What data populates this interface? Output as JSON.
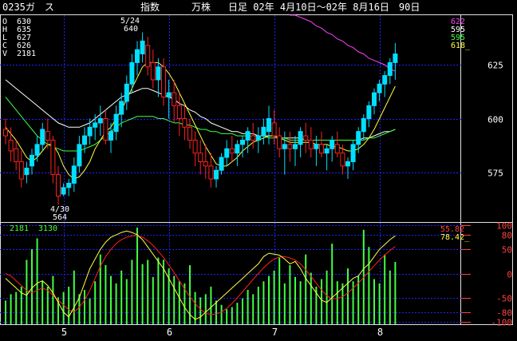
{
  "header": {
    "code": "0235ガ　ス",
    "indicator": "指数",
    "unit": "万株",
    "period": "日足 02年 4月10日～02年 8月16日　90日"
  },
  "ohlc_labels": [
    {
      "key": "O",
      "value": "630"
    },
    {
      "key": "H",
      "value": "635"
    },
    {
      "key": "L",
      "value": "627"
    },
    {
      "key": "C",
      "value": "626"
    },
    {
      "key": "V",
      "value": "2181"
    }
  ],
  "ma_values": [
    {
      "value": "622",
      "color": "#ff40ff"
    },
    {
      "value": "595",
      "color": "#ffffff"
    },
    {
      "value": "595",
      "color": "#40ff40"
    },
    {
      "value": "618_",
      "color": "#ffff40"
    }
  ],
  "osc_header": {
    "left": "2181",
    "right": "3130"
  },
  "osc_values": [
    {
      "value": "55.82",
      "color": "#ff4040"
    },
    {
      "value": "78.42_",
      "color": "#ffff40"
    }
  ],
  "annotations": [
    {
      "text": "5/24",
      "sub": "640"
    },
    {
      "text": "4/30",
      "sub": "564"
    }
  ],
  "colors": {
    "background": "#000000",
    "frame": "#e0e0e0",
    "grid": "#2020ff",
    "price_axis_text": "#ffffff",
    "osc_axis_text": "#ff4040",
    "up_candle": "#00e0ff",
    "down_candle": "#ff2020",
    "ma_short": "#ffff40",
    "ma_mid": "#ffffff",
    "ma_long": "#40ff40",
    "ma_xlong": "#ff40ff",
    "volume": "#40ff40"
  },
  "chart_data": [
    {
      "type": "candlestick",
      "title": "0235ガ　ス",
      "ylim": [
        552,
        648
      ],
      "yticks": [
        575,
        600,
        625
      ],
      "x_labels": [
        "5",
        "6",
        "7",
        "8"
      ],
      "x_label_index": [
        11,
        31,
        51,
        71
      ],
      "ohlc": [
        [
          595,
          600,
          588,
          592
        ],
        [
          590,
          596,
          580,
          585
        ],
        [
          586,
          590,
          576,
          580
        ],
        [
          580,
          585,
          568,
          572
        ],
        [
          574,
          580,
          570,
          577
        ],
        [
          578,
          586,
          574,
          583
        ],
        [
          583,
          592,
          580,
          588
        ],
        [
          588,
          598,
          585,
          595
        ],
        [
          594,
          600,
          586,
          590
        ],
        [
          590,
          592,
          570,
          574
        ],
        [
          574,
          578,
          560,
          564
        ],
        [
          565,
          570,
          564,
          568
        ],
        [
          568,
          572,
          564,
          570
        ],
        [
          570,
          582,
          566,
          578
        ],
        [
          578,
          592,
          575,
          588
        ],
        [
          588,
          596,
          584,
          592
        ],
        [
          592,
          600,
          588,
          596
        ],
        [
          596,
          602,
          590,
          598
        ],
        [
          598,
          606,
          592,
          600
        ],
        [
          600,
          604,
          588,
          590
        ],
        [
          590,
          598,
          584,
          594
        ],
        [
          594,
          606,
          590,
          602
        ],
        [
          602,
          612,
          596,
          608
        ],
        [
          608,
          620,
          604,
          616
        ],
        [
          616,
          630,
          612,
          626
        ],
        [
          626,
          636,
          620,
          632
        ],
        [
          630,
          640,
          626,
          636
        ],
        [
          634,
          638,
          620,
          624
        ],
        [
          626,
          632,
          614,
          618
        ],
        [
          618,
          628,
          610,
          624
        ],
        [
          624,
          628,
          606,
          610
        ],
        [
          610,
          618,
          600,
          612
        ],
        [
          612,
          618,
          598,
          606
        ],
        [
          606,
          612,
          592,
          600
        ],
        [
          600,
          606,
          590,
          596
        ],
        [
          596,
          600,
          586,
          590
        ],
        [
          590,
          594,
          578,
          584
        ],
        [
          584,
          590,
          574,
          580
        ],
        [
          580,
          588,
          572,
          578
        ],
        [
          578,
          584,
          568,
          572
        ],
        [
          572,
          578,
          568,
          576
        ],
        [
          576,
          584,
          574,
          582
        ],
        [
          582,
          590,
          578,
          586
        ],
        [
          586,
          592,
          580,
          584
        ],
        [
          584,
          590,
          578,
          588
        ],
        [
          588,
          592,
          582,
          590
        ],
        [
          590,
          596,
          584,
          594
        ],
        [
          592,
          598,
          586,
          590
        ],
        [
          590,
          596,
          584,
          592
        ],
        [
          592,
          600,
          588,
          596
        ],
        [
          594,
          606,
          588,
          600
        ],
        [
          598,
          604,
          588,
          592
        ],
        [
          592,
          596,
          582,
          586
        ],
        [
          586,
          594,
          574,
          588
        ],
        [
          588,
          594,
          580,
          586
        ],
        [
          586,
          592,
          578,
          588
        ],
        [
          588,
          596,
          582,
          594
        ],
        [
          592,
          598,
          584,
          590
        ],
        [
          590,
          596,
          582,
          586
        ],
        [
          586,
          592,
          578,
          588
        ],
        [
          588,
          594,
          582,
          584
        ],
        [
          584,
          588,
          576,
          586
        ],
        [
          586,
          592,
          580,
          590
        ],
        [
          588,
          594,
          582,
          584
        ],
        [
          584,
          588,
          574,
          578
        ],
        [
          578,
          582,
          572,
          580
        ],
        [
          580,
          590,
          576,
          588
        ],
        [
          588,
          596,
          584,
          594
        ],
        [
          594,
          602,
          590,
          600
        ],
        [
          600,
          608,
          596,
          606
        ],
        [
          606,
          614,
          602,
          612
        ],
        [
          612,
          618,
          608,
          616
        ],
        [
          616,
          622,
          610,
          620
        ],
        [
          620,
          628,
          616,
          626
        ],
        [
          626,
          635,
          618,
          630
        ]
      ],
      "ma": {
        "short": [
          596,
          593,
          590,
          586,
          582,
          580,
          582,
          585,
          588,
          588,
          584,
          578,
          574,
          572,
          573,
          576,
          580,
          586,
          590,
          594,
          596,
          600,
          604,
          609,
          614,
          619,
          624,
          626,
          626,
          626,
          624,
          621,
          617,
          612,
          607,
          602,
          597,
          592,
          587,
          583,
          579,
          578,
          578,
          580,
          582,
          585,
          587,
          589,
          590,
          591,
          592,
          592,
          591,
          590,
          589,
          589,
          589,
          589,
          589,
          588,
          588,
          588,
          587,
          587,
          586,
          585,
          585,
          586,
          588,
          591,
          595,
          600,
          605,
          610,
          615
        ],
        "mid": [
          618,
          616,
          614,
          612,
          610,
          608,
          606,
          604,
          602,
          600,
          598,
          597,
          596,
          596,
          596,
          597,
          598,
          600,
          602,
          604,
          606,
          608,
          610,
          611,
          612,
          613,
          614,
          614,
          613,
          612,
          611,
          610,
          609,
          607,
          606,
          604,
          603,
          601,
          600,
          598,
          597,
          596,
          595,
          594,
          594,
          593,
          593,
          593,
          592,
          592,
          592,
          592,
          591,
          591,
          591,
          591,
          591,
          590,
          590,
          590,
          590,
          590,
          590,
          590,
          590,
          590,
          590,
          590,
          591,
          591,
          592,
          593,
          594,
          594,
          595
        ],
        "long": [
          610,
          607,
          604,
          601,
          598,
          595,
          592,
          590,
          588,
          587,
          586,
          585,
          585,
          585,
          585,
          586,
          587,
          588,
          590,
          592,
          594,
          596,
          598,
          599,
          600,
          601,
          601,
          601,
          601,
          600,
          600,
          599,
          598,
          598,
          597,
          597,
          596,
          595,
          595,
          594,
          594,
          593,
          593,
          593,
          592,
          592,
          592,
          592,
          592,
          592,
          591,
          591,
          591,
          591,
          590,
          590,
          590,
          590,
          590,
          590,
          590,
          590,
          590,
          590,
          590,
          590,
          590,
          590,
          590,
          591,
          591,
          592,
          593,
          594,
          595
        ],
        "xlong": [
          null,
          null,
          null,
          null,
          null,
          null,
          null,
          null,
          null,
          null,
          null,
          null,
          null,
          null,
          null,
          null,
          null,
          null,
          null,
          null,
          null,
          null,
          null,
          null,
          null,
          null,
          null,
          null,
          null,
          null,
          null,
          null,
          null,
          null,
          null,
          null,
          null,
          null,
          null,
          null,
          null,
          null,
          null,
          null,
          null,
          null,
          null,
          null,
          null,
          null,
          null,
          null,
          null,
          null,
          650,
          648,
          647,
          646,
          645,
          643,
          642,
          640,
          639,
          637,
          636,
          634,
          633,
          631,
          630,
          628,
          627,
          626,
          625,
          623,
          622
        ]
      }
    },
    {
      "type": "bar+line",
      "ylim": [
        -100,
        100
      ],
      "yticks": [
        100,
        80,
        50,
        0,
        -50,
        -80,
        -100
      ],
      "volume": [
        22,
        28,
        30,
        35,
        60,
        70,
        80,
        40,
        35,
        45,
        25,
        30,
        35,
        50,
        28,
        32,
        24,
        40,
        65,
        55,
        45,
        38,
        50,
        42,
        60,
        90,
        56,
        60,
        44,
        62,
        60,
        52,
        45,
        40,
        38,
        55,
        30,
        25,
        28,
        35,
        22,
        18,
        14,
        16,
        20,
        24,
        32,
        28,
        35,
        40,
        45,
        50,
        62,
        38,
        55,
        44,
        40,
        65,
        48,
        35,
        42,
        50,
        75,
        40,
        38,
        52,
        40,
        45,
        88,
        72,
        42,
        38,
        65,
        50,
        58
      ],
      "osc_fast": [
        -10,
        -20,
        -30,
        -40,
        -45,
        -30,
        -20,
        -15,
        -25,
        -40,
        -60,
        -80,
        -90,
        -70,
        -50,
        -20,
        10,
        30,
        50,
        65,
        75,
        80,
        85,
        88,
        85,
        80,
        70,
        55,
        40,
        25,
        10,
        -10,
        -30,
        -50,
        -70,
        -85,
        -95,
        -90,
        -80,
        -70,
        -60,
        -50,
        -40,
        -30,
        -20,
        -10,
        0,
        10,
        20,
        35,
        42,
        40,
        38,
        30,
        20,
        25,
        10,
        -10,
        -25,
        -40,
        -55,
        -60,
        -50,
        -40,
        -30,
        -20,
        -10,
        -5,
        10,
        20,
        35,
        50,
        60,
        70,
        78
      ],
      "osc_slow": [
        0,
        -5,
        -15,
        -25,
        -35,
        -40,
        -35,
        -30,
        -35,
        -45,
        -55,
        -65,
        -75,
        -80,
        -70,
        -55,
        -35,
        -10,
        15,
        35,
        50,
        62,
        70,
        75,
        78,
        78,
        75,
        68,
        58,
        46,
        33,
        18,
        2,
        -15,
        -32,
        -48,
        -62,
        -74,
        -82,
        -85,
        -84,
        -80,
        -72,
        -62,
        -50,
        -38,
        -25,
        -12,
        0,
        12,
        22,
        30,
        34,
        35,
        32,
        28,
        20,
        8,
        -6,
        -20,
        -34,
        -46,
        -52,
        -52,
        -48,
        -40,
        -30,
        -20,
        -8,
        4,
        16,
        28,
        38,
        48,
        56
      ]
    }
  ]
}
